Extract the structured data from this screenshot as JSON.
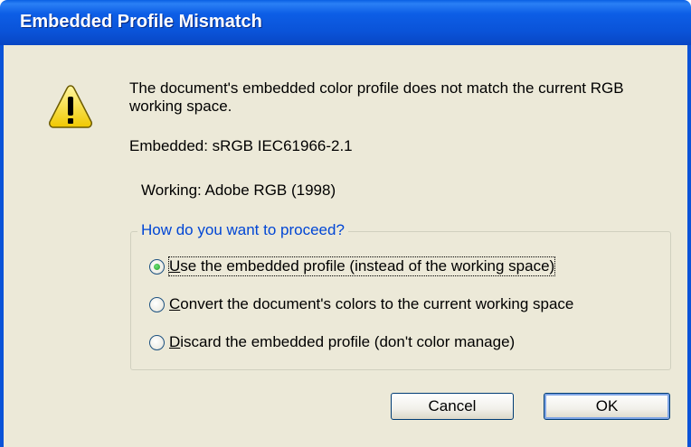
{
  "dialog": {
    "title": "Embedded Profile Mismatch",
    "message": "The document's embedded color profile does not match the current RGB working space.",
    "embedded_line": "Embedded: sRGB IEC61966-2.1",
    "working_line": "Working: Adobe RGB (1998)",
    "warning_icon": "warning-icon"
  },
  "options": {
    "legend": "How do you want to proceed?",
    "items": [
      {
        "label": "Use the embedded profile (instead of the working space)",
        "mnemonic": "U",
        "rest": "se the embedded profile (instead of the working space)",
        "checked": true
      },
      {
        "label": "Convert the document's colors to the current working space",
        "mnemonic": "C",
        "rest": "onvert the document's colors to the current working space",
        "checked": false
      },
      {
        "label": "Discard the embedded profile (don't color manage)",
        "mnemonic": "D",
        "rest": "iscard the embedded profile (don't color manage)",
        "checked": false
      }
    ]
  },
  "buttons": {
    "cancel": "Cancel",
    "ok": "OK"
  },
  "colors": {
    "title_bar": "#0a53d8",
    "dialog_bg": "#ece9d8",
    "legend_text": "#0046d5",
    "radio_selected": "#21a121"
  }
}
